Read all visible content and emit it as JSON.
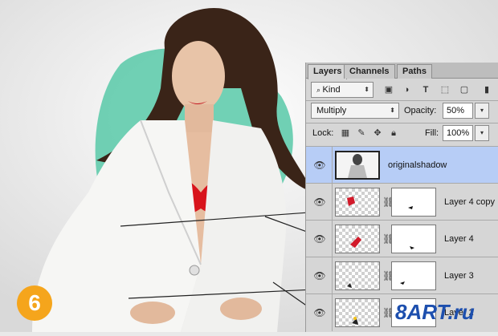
{
  "panel": {
    "tabs": [
      {
        "label": "Layers",
        "active": true
      },
      {
        "label": "Channels",
        "active": false
      },
      {
        "label": "Paths",
        "active": false
      }
    ],
    "filter": {
      "value": "Kind",
      "icons": [
        "image-filter-icon",
        "adjustment-filter-icon",
        "type-filter-icon",
        "shape-filter-icon",
        "smart-object-filter-icon",
        "filter-toggle-icon"
      ],
      "icon_glyphs": [
        "▣",
        "◑",
        "T",
        "⬚",
        "▢",
        "▮"
      ]
    },
    "blend": {
      "mode": "Multiply",
      "opacity_label": "Opacity:",
      "opacity_value": "50%"
    },
    "lock": {
      "label": "Lock:",
      "fill_label": "Fill:",
      "fill_value": "100%"
    },
    "layers": [
      {
        "name": "originalshadow",
        "selected": true,
        "type": "photo"
      },
      {
        "name": "Layer 4 copy",
        "selected": false,
        "type": "masked"
      },
      {
        "name": "Layer 4",
        "selected": false,
        "type": "masked"
      },
      {
        "name": "Layer 3",
        "selected": false,
        "type": "masked"
      },
      {
        "name": "Layer 2",
        "selected": false,
        "type": "masked"
      }
    ]
  },
  "step_badge": "6",
  "watermark": "8ART.ru",
  "colors": {
    "selection": "#b7cdf6",
    "panel": "#d6d6d6",
    "badge": "#f5a51c",
    "accent_teal": "#58c9a8",
    "watermark": "#1d4fae"
  }
}
